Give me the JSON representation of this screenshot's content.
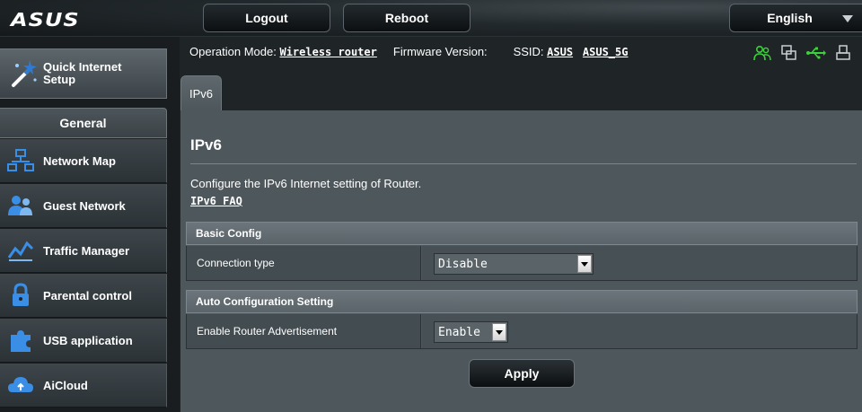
{
  "header": {
    "logo": "ASUS",
    "logout_label": "Logout",
    "reboot_label": "Reboot",
    "language": "English"
  },
  "status": {
    "operation_mode_label": "Operation Mode:",
    "operation_mode_value": "Wireless router",
    "firmware_label": "Firmware Version:",
    "ssid_label": "SSID:",
    "ssid_1": "ASUS",
    "ssid_2": "ASUS_5G",
    "icons": [
      "clients-icon",
      "network-icon",
      "usb-icon",
      "printer-icon"
    ]
  },
  "sidebar": {
    "quick_setup_label": "Quick Internet Setup",
    "general_label": "General",
    "items": [
      {
        "label": "Network Map",
        "icon": "network-map-icon"
      },
      {
        "label": "Guest Network",
        "icon": "guest-network-icon"
      },
      {
        "label": "Traffic Manager",
        "icon": "traffic-manager-icon"
      },
      {
        "label": "Parental control",
        "icon": "lock-icon"
      },
      {
        "label": "USB application",
        "icon": "puzzle-icon"
      },
      {
        "label": "AiCloud",
        "icon": "cloud-icon"
      }
    ]
  },
  "tabs": [
    {
      "label": "IPv6"
    }
  ],
  "main": {
    "title": "IPv6",
    "description": "Configure the IPv6 Internet setting of Router.",
    "faq_link": "IPv6 FAQ",
    "sections": [
      {
        "title": "Basic Config",
        "rows": [
          {
            "label": "Connection type",
            "value": "Disable"
          }
        ]
      },
      {
        "title": "Auto Configuration Setting",
        "rows": [
          {
            "label": "Enable Router Advertisement",
            "value": "Enable"
          }
        ]
      }
    ],
    "apply_label": "Apply"
  },
  "colors": {
    "status_icon_green": "#3bd23b",
    "panel_bg": "#4e575c",
    "nav_bg": "#2b3236"
  }
}
